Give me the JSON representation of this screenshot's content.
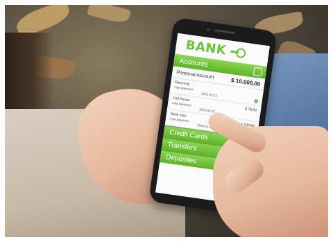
{
  "app": {
    "brand": "BANK",
    "accounts_label": "Accounts",
    "personal_account": {
      "label": "Personal Account",
      "amount": "$ 10.000,00"
    },
    "transactions": [
      {
        "name": "Electricity",
        "last_payment_label": "Last payment:",
        "date": "2015-02-12",
        "amount": ""
      },
      {
        "name": "Cell Phone",
        "last_payment_label": "Last payment:",
        "date": "2015-02-01",
        "amount": "$ 75,00"
      },
      {
        "name": "Bank Visa",
        "last_payment_label": "Last payment:",
        "date": "2015-01-29",
        "amount": "$ 100,00"
      }
    ],
    "menu": [
      "Credit Cards",
      "Transfers",
      "Deposites"
    ]
  },
  "colors": {
    "accent": "#6cc23a",
    "bar_top": "#8bd550",
    "bar_bottom": "#5db32a"
  }
}
